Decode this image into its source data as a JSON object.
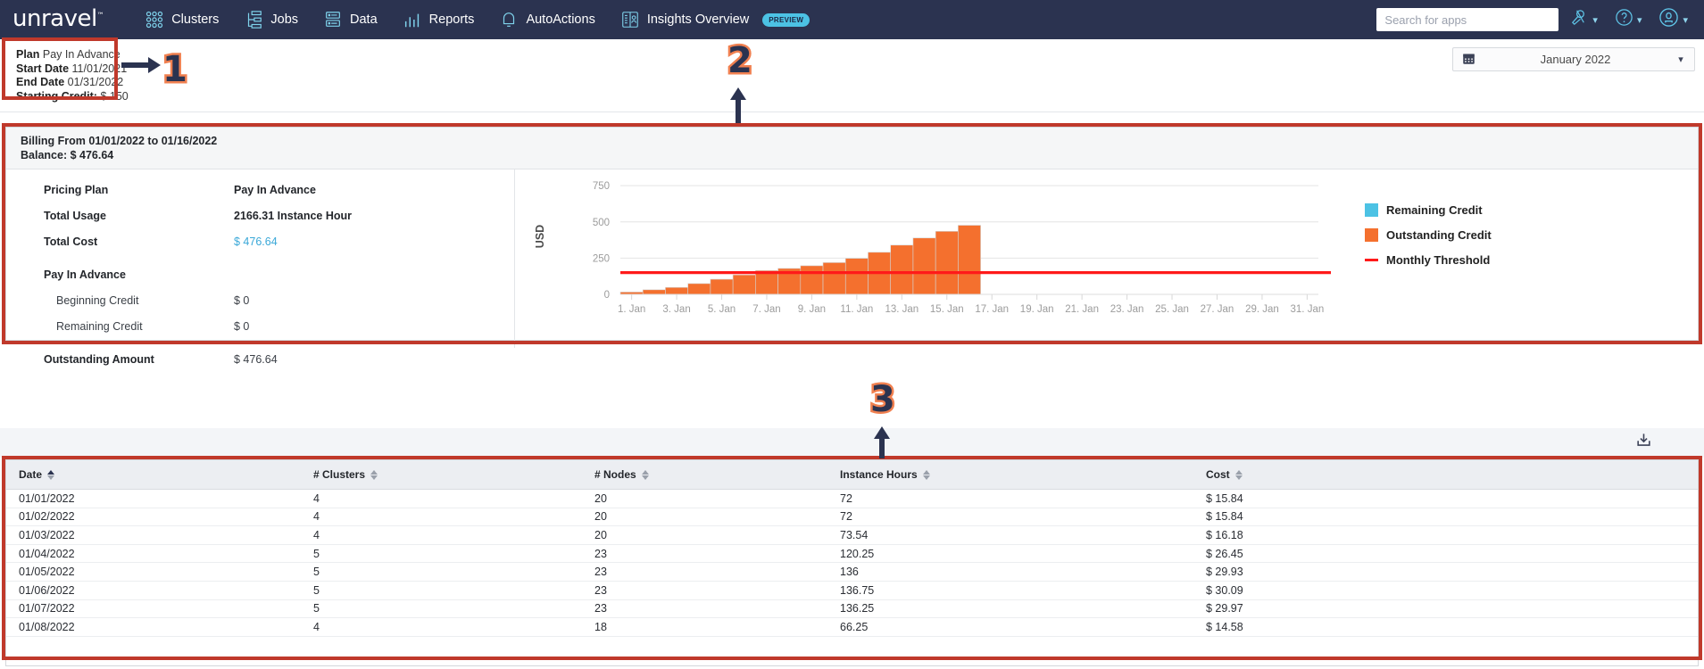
{
  "nav": {
    "logo": "unravel",
    "logo_tm": "™",
    "items": [
      {
        "label": "Clusters",
        "icon": "clusters-icon"
      },
      {
        "label": "Jobs",
        "icon": "jobs-icon"
      },
      {
        "label": "Data",
        "icon": "data-icon"
      },
      {
        "label": "Reports",
        "icon": "reports-icon"
      },
      {
        "label": "AutoActions",
        "icon": "bell-icon"
      },
      {
        "label": "Insights Overview",
        "icon": "insights-icon",
        "badge": "PREVIEW"
      }
    ],
    "search_placeholder": "Search for apps",
    "search_value": "",
    "right_icons": [
      "tools-icon",
      "help-icon",
      "account-icon"
    ]
  },
  "plan_info": {
    "plan_label": "Plan",
    "plan_value": "Pay In Advance",
    "start_label": "Start Date",
    "start_value": "11/01/2021",
    "end_label": "End Date",
    "end_value": "01/31/2022",
    "credit_label": "Starting Credit:",
    "credit_value": "$ 150"
  },
  "datepicker": {
    "icon": "calendar-icon",
    "value": "January 2022",
    "caret": "chevron-down-icon"
  },
  "annotations": [
    {
      "number": "1",
      "target": "plan-info-box"
    },
    {
      "number": "2",
      "target": "billing-summary-panel"
    },
    {
      "number": "3",
      "target": "usage-table"
    }
  ],
  "billing": {
    "header_line1": "Billing From 01/01/2022 to 01/16/2022",
    "header_line2": "Balance: $ 476.64",
    "rows": [
      {
        "label": "Pricing Plan",
        "value": "Pay In Advance",
        "style": "bold",
        "indent": false
      },
      {
        "label": "Total Usage",
        "value": "2166.31 Instance Hour",
        "style": "bold",
        "indent": false
      },
      {
        "label": "Total Cost",
        "value": "$ 476.64",
        "style": "link",
        "indent": false
      },
      {
        "label": "Pay In Advance",
        "value": "",
        "style": "bold",
        "indent": false
      },
      {
        "label": "Beginning Credit",
        "value": "$ 0",
        "style": "plain",
        "indent": true
      },
      {
        "label": "Remaining Credit",
        "value": "$ 0",
        "style": "plain",
        "indent": true
      },
      {
        "label": "Outstanding Amount",
        "value": "$ 476.64",
        "style": "plain",
        "indent": false
      }
    ]
  },
  "chart_data": {
    "type": "bar",
    "title": "",
    "xlabel": "",
    "ylabel": "USD",
    "ylim": [
      0,
      800
    ],
    "yticks": [
      0,
      250,
      500,
      750
    ],
    "grid": true,
    "legend_position": "right",
    "x_tick_labels": [
      "1. Jan",
      "3. Jan",
      "5. Jan",
      "7. Jan",
      "9. Jan",
      "11. Jan",
      "13. Jan",
      "15. Jan",
      "17. Jan",
      "19. Jan",
      "21. Jan",
      "23. Jan",
      "25. Jan",
      "27. Jan",
      "29. Jan",
      "31. Jan"
    ],
    "x_domain": [
      "1. Jan",
      "31. Jan"
    ],
    "categories": [
      "1",
      "2",
      "3",
      "4",
      "5",
      "6",
      "7",
      "8",
      "9",
      "10",
      "11",
      "12",
      "13",
      "14",
      "15",
      "16",
      "17",
      "18",
      "19",
      "20",
      "21",
      "22",
      "23",
      "24",
      "25",
      "26",
      "27",
      "28",
      "29",
      "30",
      "31"
    ],
    "series": [
      {
        "name": "Outstanding Credit",
        "color": "#f4702e",
        "values": [
          15.84,
          31.68,
          47.86,
          74.31,
          104.24,
          134.33,
          164.3,
          178.88,
          197.38,
          219.12,
          248.46,
          290.35,
          339.79,
          389.0,
          434.88,
          476.64,
          null,
          null,
          null,
          null,
          null,
          null,
          null,
          null,
          null,
          null,
          null,
          null,
          null,
          null,
          null
        ]
      },
      {
        "name": "Remaining Credit",
        "color": "#4cc2e4",
        "values": [
          null,
          null,
          null,
          null,
          null,
          null,
          null,
          null,
          null,
          null,
          null,
          null,
          null,
          null,
          null,
          null,
          null,
          null,
          null,
          null,
          null,
          null,
          null,
          null,
          null,
          null,
          null,
          null,
          null,
          null,
          null
        ]
      }
    ],
    "threshold": {
      "name": "Monthly Threshold",
      "value": 150,
      "color": "#ff1a1a"
    },
    "legend": [
      {
        "label": "Remaining Credit",
        "color": "#4cc2e4",
        "marker": "square"
      },
      {
        "label": "Outstanding Credit",
        "color": "#f4702e",
        "marker": "square"
      },
      {
        "label": "Monthly Threshold",
        "color": "#ff1a1a",
        "marker": "line"
      }
    ]
  },
  "download": {
    "icon": "download-icon",
    "label": ""
  },
  "table": {
    "columns": [
      {
        "key": "date",
        "label": "Date",
        "sorted": "asc"
      },
      {
        "key": "clusters",
        "label": "# Clusters",
        "sorted": "none"
      },
      {
        "key": "nodes",
        "label": "# Nodes",
        "sorted": "none"
      },
      {
        "key": "hours",
        "label": "Instance Hours",
        "sorted": "none"
      },
      {
        "key": "cost",
        "label": "Cost",
        "sorted": "none"
      }
    ],
    "rows": [
      {
        "date": "01/01/2022",
        "clusters": "4",
        "nodes": "20",
        "hours": "72",
        "cost": "$ 15.84"
      },
      {
        "date": "01/02/2022",
        "clusters": "4",
        "nodes": "20",
        "hours": "72",
        "cost": "$ 15.84"
      },
      {
        "date": "01/03/2022",
        "clusters": "4",
        "nodes": "20",
        "hours": "73.54",
        "cost": "$ 16.18"
      },
      {
        "date": "01/04/2022",
        "clusters": "5",
        "nodes": "23",
        "hours": "120.25",
        "cost": "$ 26.45"
      },
      {
        "date": "01/05/2022",
        "clusters": "5",
        "nodes": "23",
        "hours": "136",
        "cost": "$ 29.93"
      },
      {
        "date": "01/06/2022",
        "clusters": "5",
        "nodes": "23",
        "hours": "136.75",
        "cost": "$ 30.09"
      },
      {
        "date": "01/07/2022",
        "clusters": "5",
        "nodes": "23",
        "hours": "136.25",
        "cost": "$ 29.97"
      },
      {
        "date": "01/08/2022",
        "clusters": "4",
        "nodes": "18",
        "hours": "66.25",
        "cost": "$ 14.58"
      }
    ]
  },
  "colors": {
    "nav_bg": "#2b3350",
    "accent_cyan": "#4cc2e4",
    "bar_orange": "#f4702e",
    "threshold_red": "#ff1a1a",
    "annotation_red": "#c0392b",
    "link_blue": "#3aa8d8"
  }
}
